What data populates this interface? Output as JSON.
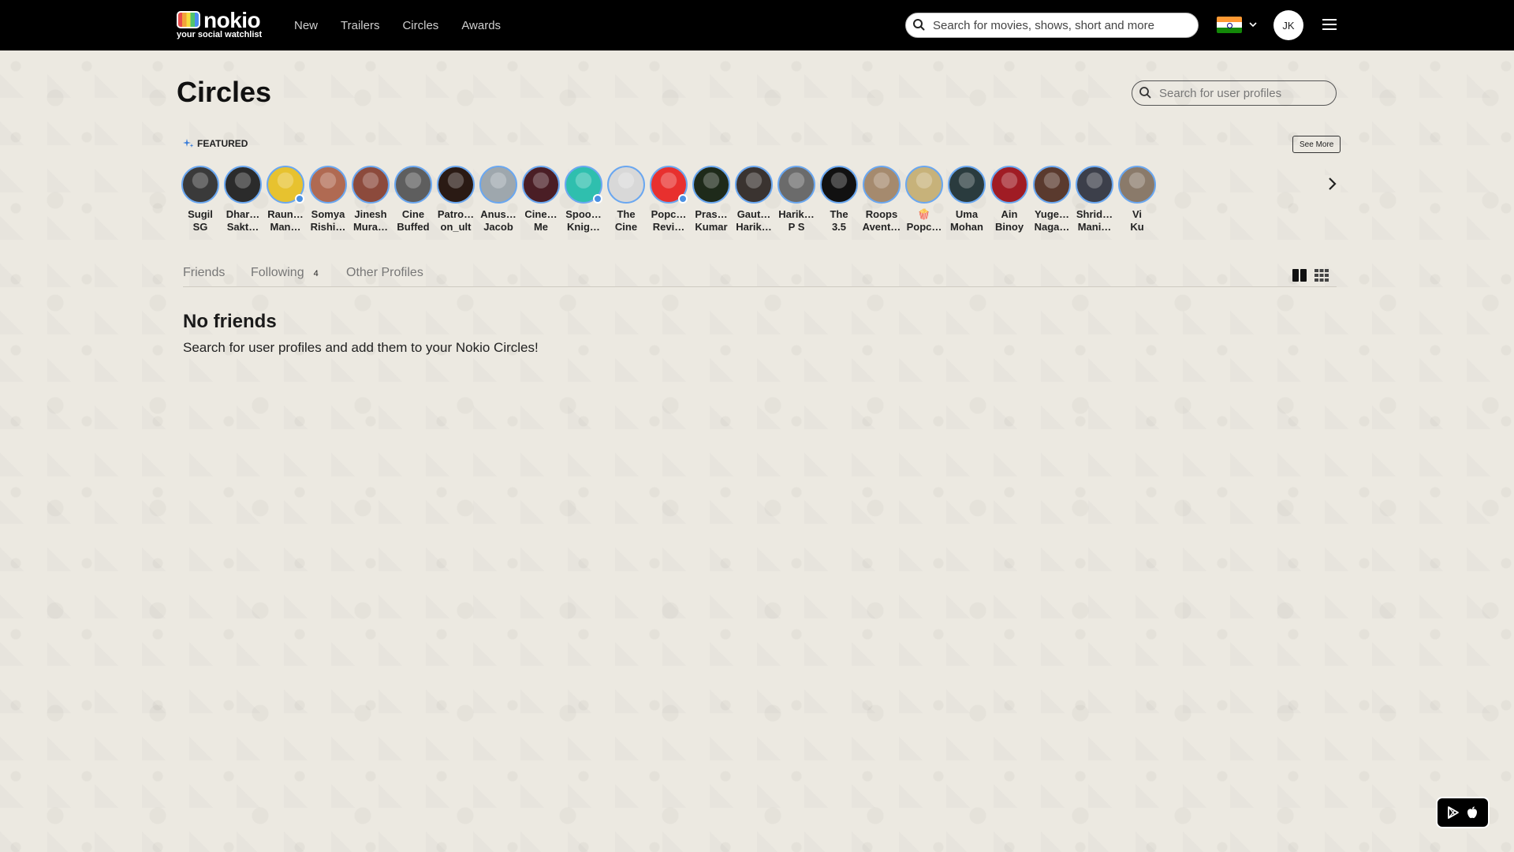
{
  "header": {
    "logo_word": "nokio",
    "logo_tagline": "your social watchlist",
    "nav": [
      "New",
      "Trailers",
      "Circles",
      "Awards"
    ],
    "search_placeholder": "Search for movies, shows, short and more",
    "user_initials": "JK"
  },
  "page": {
    "title": "Circles",
    "user_search_placeholder": "Search for user profiles"
  },
  "featured": {
    "label": "FEATURED",
    "see_more": "See More",
    "profiles": [
      {
        "line1": "Sugil",
        "line2": "SG",
        "color": "#3a3a3a",
        "verified": false
      },
      {
        "line1": "Dhar…",
        "line2": "Sakt…",
        "color": "#2b2b2b",
        "verified": false
      },
      {
        "line1": "Raun…",
        "line2": "Man…",
        "color": "#e7c22f",
        "verified": true
      },
      {
        "line1": "Somya",
        "line2": "Rishi…",
        "color": "#b06a52",
        "verified": false
      },
      {
        "line1": "Jinesh",
        "line2": "Mura…",
        "color": "#8c4a3c",
        "verified": false
      },
      {
        "line1": "Cine",
        "line2": "Buffed",
        "color": "#5e5e5e",
        "verified": false
      },
      {
        "line1": "Patro…",
        "line2": "on_ult",
        "color": "#2a1a14",
        "verified": false
      },
      {
        "line1": "Anus…",
        "line2": "Jacob",
        "color": "#9ea7ad",
        "verified": false
      },
      {
        "line1": "Cine…",
        "line2": "Me",
        "color": "#4a1e25",
        "verified": false
      },
      {
        "line1": "Spoo…",
        "line2": "Knig…",
        "color": "#2fbfae",
        "verified": true
      },
      {
        "line1": "The",
        "line2": "Cine",
        "color": "#d8d8d8",
        "verified": false
      },
      {
        "line1": "Popc…",
        "line2": "Revi…",
        "color": "#e8302e",
        "verified": true
      },
      {
        "line1": "Pras…",
        "line2": "Kumar",
        "color": "#1e2a1a",
        "verified": false
      },
      {
        "line1": "Gaut…",
        "line2": "Harik…",
        "color": "#3a3330",
        "verified": false
      },
      {
        "line1": "Harik…",
        "line2": "P S",
        "color": "#6b6b6b",
        "verified": false
      },
      {
        "line1": "The",
        "line2": "3.5",
        "color": "#111111",
        "verified": false
      },
      {
        "line1": "Roops",
        "line2": "Avent…",
        "color": "#a58a6e",
        "verified": false
      },
      {
        "line1": "🍿",
        "line2": "Popc…",
        "color": "#c7b27a",
        "verified": false
      },
      {
        "line1": "Uma",
        "line2": "Mohan",
        "color": "#2a3b3e",
        "verified": false
      },
      {
        "line1": "Ain",
        "line2": "Binoy",
        "color": "#a01c24",
        "verified": false
      },
      {
        "line1": "Yuge…",
        "line2": "Naga…",
        "color": "#5a3a2e",
        "verified": false
      },
      {
        "line1": "Shrid…",
        "line2": "Mani…",
        "color": "#3c3f4a",
        "verified": false
      },
      {
        "line1": "Vi",
        "line2": "Ku",
        "color": "#8a7a6a",
        "verified": false
      }
    ]
  },
  "tabs": [
    {
      "label": "Friends",
      "count": ""
    },
    {
      "label": "Following",
      "count": "4"
    },
    {
      "label": "Other Profiles",
      "count": ""
    }
  ],
  "empty_state": {
    "title": "No friends",
    "message": "Search for user profiles and add them to your Nokio Circles!"
  },
  "icons": {
    "search": "search-icon",
    "menu": "menu-icon",
    "chevron": "chevron-down-icon",
    "view_two_column": "two-column-view-icon",
    "view_grid": "grid-view-icon",
    "play_store": "play-store-icon",
    "apple": "apple-icon"
  }
}
